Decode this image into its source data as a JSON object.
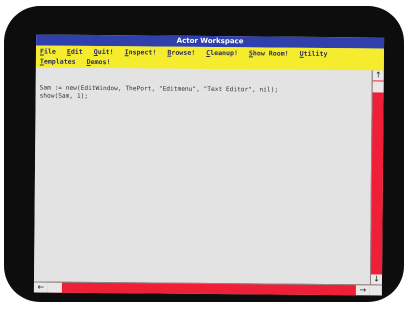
{
  "window": {
    "title": "Actor Workspace"
  },
  "menu": {
    "row1": [
      "File",
      "Edit",
      "Quit!",
      "Inspect!",
      "Browse!",
      "Cleanup!",
      "Show Room!",
      "Utility"
    ],
    "row2": [
      "Templates",
      "Demos!"
    ]
  },
  "editor": {
    "lines": [
      "Sam := new(EditWindow, ThePort, \"Editmenu\", \"Text Editor\", nil);",
      "show(Sam, 1);"
    ]
  },
  "scrollbar": {
    "up_glyph": "↑",
    "down_glyph": "↓",
    "left_glyph": "←",
    "right_glyph": "→"
  },
  "colors": {
    "title_bar": "#2f40ad",
    "menu_bar": "#f6ec2e",
    "scrollbar": "#ee1f37",
    "editor_bg": "#e3e3e3"
  }
}
